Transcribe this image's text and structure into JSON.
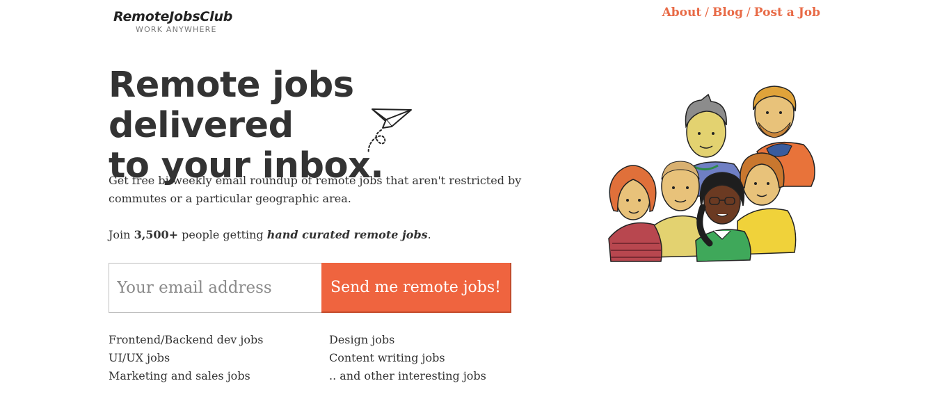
{
  "logo": {
    "title": "RemoteJobsClub",
    "tagline": "WORK ANYWHERE"
  },
  "nav": [
    {
      "label": "About"
    },
    {
      "label": "Blog"
    },
    {
      "label": "Post a Job"
    }
  ],
  "nav_separator": "/",
  "hero": {
    "title_line1": "Remote jobs delivered",
    "title_line2": "to your inbox.",
    "description": "Get free bi-weekly email roundup of remote jobs that aren't restricted by commutes or a particular geographic area.",
    "join_prefix": "Join ",
    "join_count": "3,500+",
    "join_middle": " people getting ",
    "join_emphasis": "hand curated remote jobs",
    "join_suffix": "."
  },
  "signup": {
    "email_value": "",
    "email_placeholder": "Your email address",
    "button_label": "Send me remote jobs!"
  },
  "categories": {
    "left": [
      "Frontend/Backend dev jobs",
      "UI/UX jobs",
      "Marketing and sales jobs"
    ],
    "right": [
      "Design jobs",
      "Content writing jobs",
      ".. and other interesting jobs"
    ]
  },
  "colors": {
    "accent": "#ef643f",
    "nav": "#e86a46",
    "text": "#333333"
  },
  "icons": {
    "hero_decoration": "paper-plane-icon",
    "illustration": "team-illustration"
  }
}
